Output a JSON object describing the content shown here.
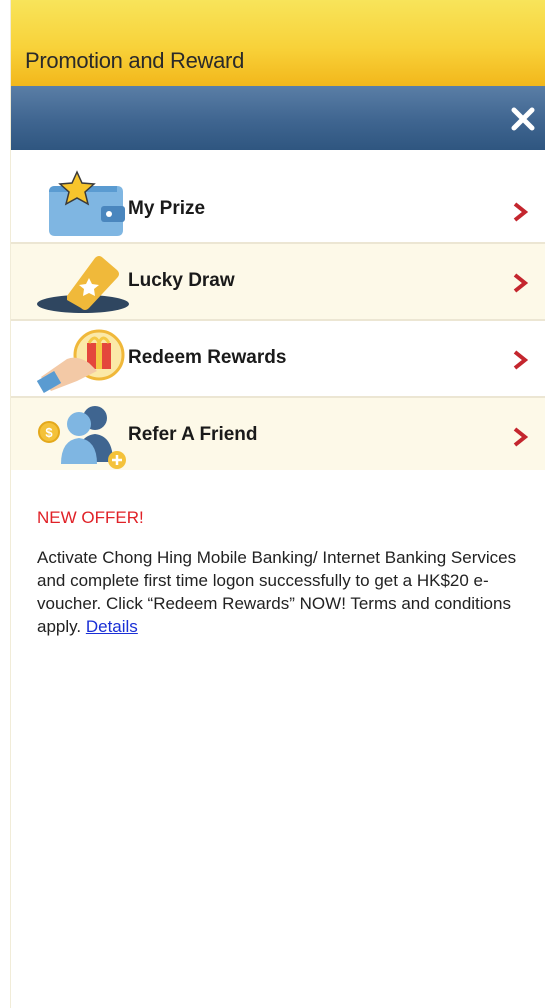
{
  "header": {
    "title": "Promotion and Reward"
  },
  "menu": {
    "items": [
      {
        "label": "My Prize",
        "icon": "prize-wallet-icon"
      },
      {
        "label": "Lucky Draw",
        "icon": "lucky-ticket-icon"
      },
      {
        "label": "Redeem Rewards",
        "icon": "gift-hand-icon"
      },
      {
        "label": "Refer A Friend",
        "icon": "friends-icon"
      }
    ]
  },
  "offer": {
    "heading": "NEW OFFER!",
    "body": "Activate Chong Hing Mobile Banking/ Internet Banking Services and complete first time logon successfully to get a HK$20 e-voucher. Click “Redeem Rewards” NOW! Terms and conditions apply.",
    "link": "Details"
  },
  "colors": {
    "header_yellow": "#f8d23a",
    "nav_blue": "#3f6590",
    "chevron_red": "#c4262e",
    "offer_red": "#e02127",
    "link_blue": "#1a2fd6"
  }
}
